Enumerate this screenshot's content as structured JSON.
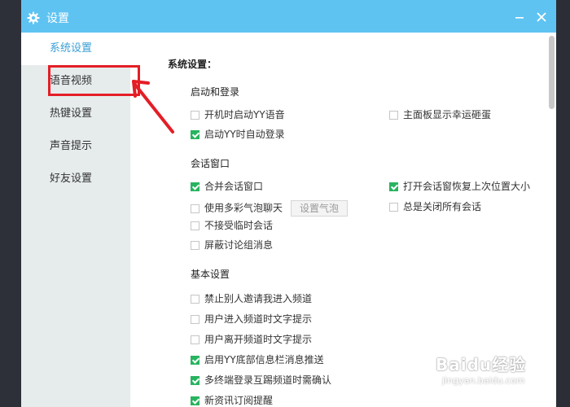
{
  "window": {
    "title": "设置"
  },
  "sidebar": {
    "items": [
      {
        "label": "系统设置",
        "active": true
      },
      {
        "label": "语音视频",
        "active": false
      },
      {
        "label": "热键设置",
        "active": false
      },
      {
        "label": "声音提示",
        "active": false
      },
      {
        "label": "好友设置",
        "active": false
      }
    ]
  },
  "main": {
    "heading": "系统设置：",
    "sections": [
      {
        "title": "启动和登录",
        "options": [
          {
            "label": "开机时启动YY语音",
            "checked": false
          },
          {
            "label": "主面板显示幸运砸蛋",
            "checked": false
          },
          {
            "label": "启动YY时自动登录",
            "checked": true
          }
        ]
      },
      {
        "title": "会话窗口",
        "options": [
          {
            "label": "合并会话窗口",
            "checked": true
          },
          {
            "label": "打开会话窗恢复上次位置大小",
            "checked": true
          },
          {
            "label": "使用多彩气泡聊天",
            "checked": false,
            "button": "设置气泡"
          },
          {
            "label": "总是关闭所有会话",
            "checked": false
          },
          {
            "label": "不接受临时会话",
            "checked": false
          },
          {
            "label": "屏蔽讨论组消息",
            "checked": false
          }
        ]
      },
      {
        "title": "基本设置",
        "options": [
          {
            "label": "禁止别人邀请我进入频道",
            "checked": false
          },
          {
            "label": "用户进入频道时文字提示",
            "checked": false
          },
          {
            "label": "用户离开频道时文字提示",
            "checked": false
          },
          {
            "label": "启用YY底部信息栏消息推送",
            "checked": true
          },
          {
            "label": "多终端登录互踢频道时需确认",
            "checked": true
          },
          {
            "label": "新资讯订阅提醒",
            "checked": true
          }
        ]
      }
    ]
  },
  "watermark": {
    "brand": "Baidu经验",
    "url": "jingyan.baidu.com"
  },
  "colors": {
    "titlebar": "#5fc3f2",
    "active_nav": "#3a9fd4",
    "checked": "#28b35f",
    "annotation": "#e41e26"
  },
  "icons": {
    "title": "gear-icon",
    "minimize": "minimize-icon",
    "close": "close-icon"
  }
}
